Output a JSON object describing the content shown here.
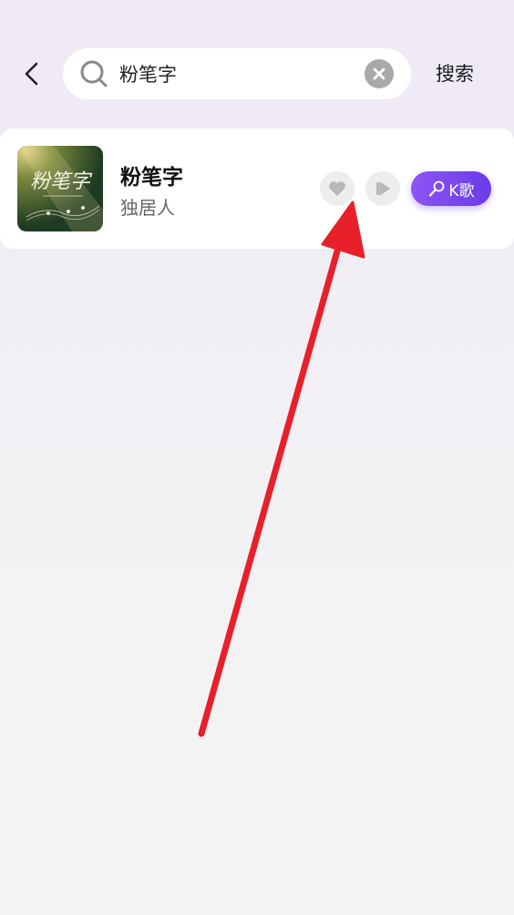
{
  "header": {
    "back_icon": "chevron-left-icon",
    "search": {
      "icon": "search-icon",
      "value": "粉笔字",
      "clear_icon": "close-icon"
    },
    "search_button_label": "搜索"
  },
  "results": [
    {
      "cover_icon": "album-cover",
      "cover_text": "粉笔字",
      "title": "粉笔字",
      "artist": "独居人",
      "like_icon": "heart-icon",
      "play_icon": "play-icon",
      "karaoke_icon": "microphone-icon",
      "karaoke_label": "K歌"
    }
  ],
  "colors": {
    "accent": "#7b48ee",
    "annotation_arrow": "#e8202a",
    "background_top": "#efe9f6",
    "background_bottom": "#f3f3f4"
  }
}
